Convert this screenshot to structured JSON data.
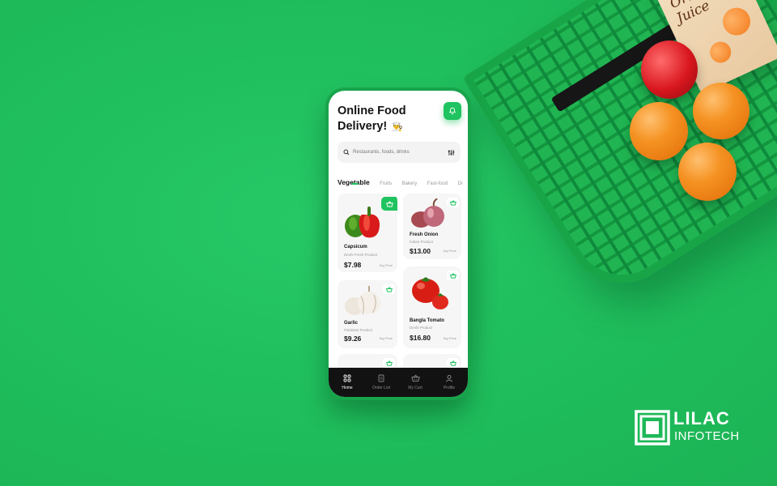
{
  "app": {
    "title": "Online Food Delivery!",
    "title_emoji": "👨‍🍳"
  },
  "search": {
    "placeholder": "Restaurants, foods, drinks"
  },
  "categories": [
    {
      "label": "Vegetable",
      "active": true
    },
    {
      "label": "Fruits",
      "active": false
    },
    {
      "label": "Bakery",
      "active": false
    },
    {
      "label": "Fast-food",
      "active": false
    },
    {
      "label": "Dr",
      "active": false
    }
  ],
  "products": [
    {
      "name": "Capsicum",
      "subtitle": "Deshi Fresh Product",
      "price": "$7.98",
      "unit": "1kg Price"
    },
    {
      "name": "Fresh Onion",
      "subtitle": "Indian Product",
      "price": "$13.00",
      "unit": "1kg Price"
    },
    {
      "name": "Garlic",
      "subtitle": "Pakistani Product",
      "price": "$9.26",
      "unit": "1kg Price"
    },
    {
      "name": "Bangla Tomato",
      "subtitle": "Deshi Product",
      "price": "$16.80",
      "unit": "1kg Price"
    }
  ],
  "nav": [
    {
      "label": "Home",
      "icon": "grid-icon",
      "active": true
    },
    {
      "label": "Order List",
      "icon": "clipboard-icon",
      "active": false
    },
    {
      "label": "My Cart",
      "icon": "basket-icon",
      "active": false
    },
    {
      "label": "Profile",
      "icon": "user-icon",
      "active": false
    }
  ],
  "juice": {
    "label": "Orange Juice"
  },
  "brand": {
    "line1": "LILAC",
    "line2": "INFOTECH"
  },
  "colors": {
    "background": "#1fbd5c",
    "accent": "#1fc35f",
    "nav_bar": "#121212"
  }
}
